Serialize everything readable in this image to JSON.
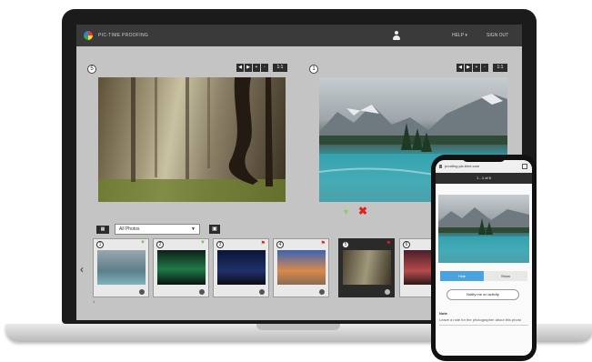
{
  "app": {
    "brand": "PIC-TIME PROOFING",
    "help_label": "HELP ▾",
    "signout_label": "SIGN OUT"
  },
  "left_pane": {
    "badge": "5",
    "zoom_controls": [
      "◀",
      "▶",
      "+",
      "-"
    ],
    "zoom_level": "1:1"
  },
  "right_pane": {
    "badge": "1",
    "zoom_controls": [
      "◀",
      "▶",
      "+",
      "-"
    ],
    "zoom_level": "1:1"
  },
  "filmstrip": {
    "grid_label": "▦",
    "filter_value": "All Photos",
    "monitor_label": "▣",
    "prev_label": "‹",
    "thumbnails": [
      {
        "number": "1",
        "mark": "▼"
      },
      {
        "number": "2",
        "mark": "▼"
      },
      {
        "number": "3",
        "mark": "⚑"
      },
      {
        "number": "4",
        "mark": "⚑"
      },
      {
        "number": "5",
        "mark": "⚑"
      },
      {
        "number": "6",
        "mark": ""
      }
    ],
    "footer": "1"
  },
  "phone": {
    "url": "proofing.pic-time.com",
    "header": "1 - 1 of 6",
    "toggle_on": "Hide",
    "toggle_off": "Show",
    "notify_button": "Notify me on activity",
    "label": "Note",
    "description": "Leave a note for the photographer about this photo"
  },
  "colors": {
    "accent_green": "#6cc04a",
    "accent_red": "#e02020",
    "toggle_blue": "#4aa3df",
    "topbar": "#3a3a3a"
  }
}
